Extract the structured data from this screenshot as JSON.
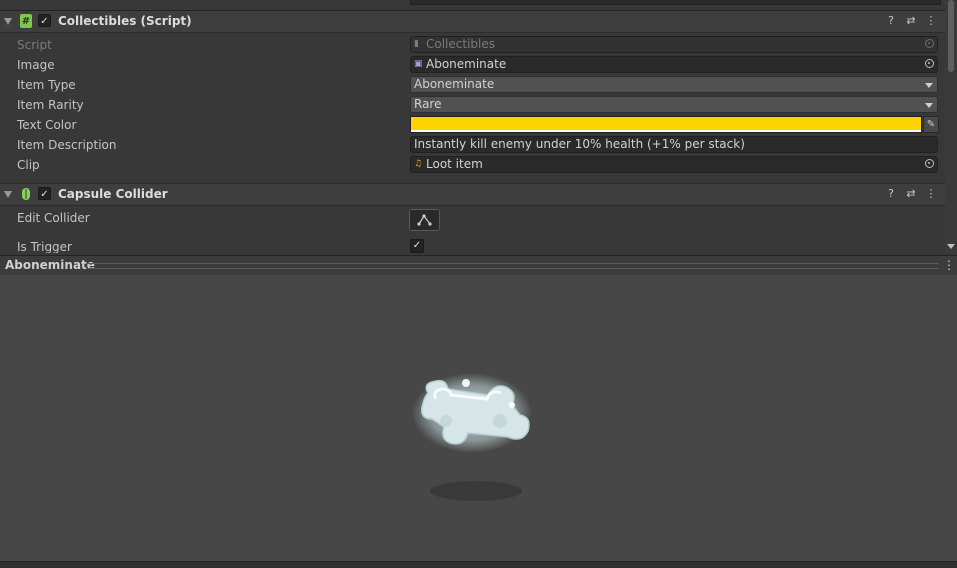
{
  "components": {
    "collectibles": {
      "title": "Collectibles (Script)",
      "icon": "hash-script-icon",
      "enabled": "✓"
    },
    "capsule_collider": {
      "title": "Capsule Collider",
      "icon": "capsule-collider-icon",
      "enabled": "✓"
    }
  },
  "properties": {
    "script": {
      "label": "Script",
      "value": "Collectibles"
    },
    "image": {
      "label": "Image",
      "value": "Aboneminate"
    },
    "item_type": {
      "label": "Item Type",
      "value": "Aboneminate"
    },
    "item_rarity": {
      "label": "Item Rarity",
      "value": "Rare"
    },
    "text_color": {
      "label": "Text Color",
      "color": "#fdd300"
    },
    "item_description": {
      "label": "Item Description",
      "value": "Instantly kill enemy under 10% health (+1% per stack)"
    },
    "clip": {
      "label": "Clip",
      "value": "Loot item"
    },
    "edit_collider": {
      "label": "Edit Collider"
    },
    "is_trigger": {
      "label": "Is Trigger",
      "value": "✓"
    }
  },
  "header_buttons": {
    "help": "?",
    "presets": "⇄",
    "menu": "⋮"
  },
  "preview": {
    "title": "Aboneminate",
    "menu": "⋮"
  },
  "colors": {
    "accent_yellow": "#fdd300",
    "script_icon_green": "#7ec850",
    "panel_bg": "#383838",
    "preview_bg": "#474747"
  }
}
